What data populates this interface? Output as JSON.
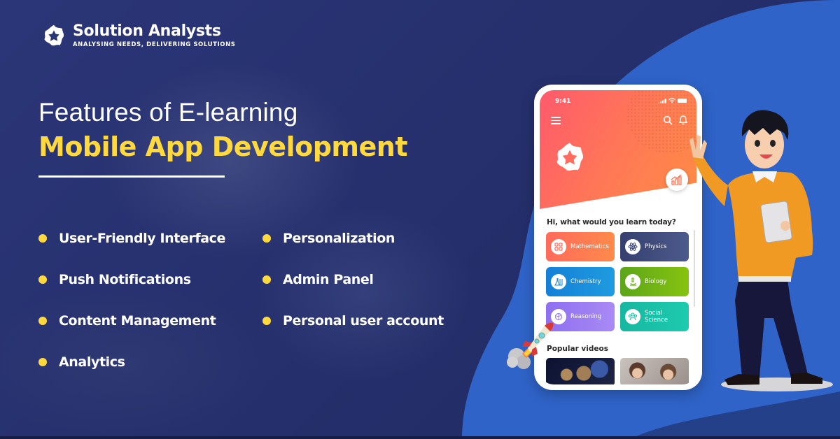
{
  "brand": {
    "name": "Solution Analysts",
    "tagline": "ANALYSING NEEDS, DELIVERING SOLUTIONS",
    "logo_icon": "star-logo-icon"
  },
  "heading": {
    "line1": "Features of E-learning",
    "line2": "Mobile App Development"
  },
  "features": [
    {
      "label": "User-Friendly Interface"
    },
    {
      "label": "Personalization"
    },
    {
      "label": "Push Notifications"
    },
    {
      "label": "Admin Panel"
    },
    {
      "label": "Content Management"
    },
    {
      "label": "Personal user account"
    },
    {
      "label": "Analytics"
    }
  ],
  "phone": {
    "status_time": "9:41",
    "greeting": "Hi, what would you learn today?",
    "subjects": [
      {
        "label": "Mathematics",
        "icon": "calculator-icon",
        "color": "#ff6b5b"
      },
      {
        "label": "Physics",
        "icon": "atom-icon",
        "color": "#3c4a7e"
      },
      {
        "label": "Chemistry",
        "icon": "flask-icon",
        "color": "#1f88d8"
      },
      {
        "label": "Biology",
        "icon": "microscope-icon",
        "color": "#6cb41a"
      },
      {
        "label": "Reasoning",
        "icon": "brain-icon",
        "color": "#9b7ff0"
      },
      {
        "label": "Social\nScience",
        "icon": "people-icon",
        "color": "#19c2a5"
      }
    ],
    "videos_title": "Popular videos",
    "videos": [
      {
        "subject": "planets"
      },
      {
        "subject": "children learning"
      }
    ]
  },
  "colors": {
    "background": "#26306d",
    "accent_yellow": "#ffd93d",
    "blob_blue": "#2f63c7",
    "hero_gradient_start": "#ff5a6b",
    "hero_gradient_end": "#ff8c45"
  }
}
